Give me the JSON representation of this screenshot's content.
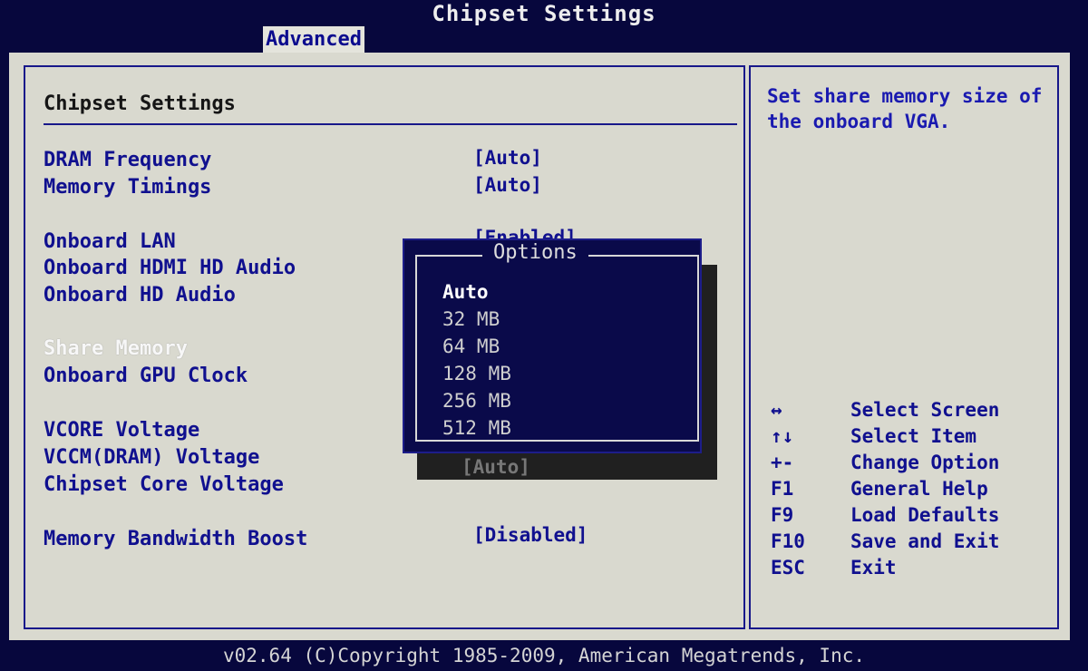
{
  "window": {
    "title": "Chipset Settings",
    "tab": "Advanced"
  },
  "left_panel": {
    "section_title": "Chipset Settings",
    "settings": [
      {
        "label": "DRAM Frequency",
        "value": "[Auto]"
      },
      {
        "label": "Memory Timings",
        "value": "[Auto]"
      },
      {
        "label": "Onboard LAN",
        "value": "[Enabled]"
      },
      {
        "label": "Onboard HDMI HD Audio",
        "value": ""
      },
      {
        "label": "Onboard HD Audio",
        "value": ""
      },
      {
        "label": "Share Memory",
        "value": "",
        "selected": true
      },
      {
        "label": "Onboard GPU Clock",
        "value": ""
      },
      {
        "label": "VCORE Voltage",
        "value": ""
      },
      {
        "label": "VCCM(DRAM) Voltage",
        "value": ""
      },
      {
        "label": "Chipset Core Voltage",
        "value": "[Auto]"
      },
      {
        "label": "Memory Bandwidth Boost",
        "value": "[Disabled]"
      }
    ]
  },
  "options_popup": {
    "title": "Options",
    "items": [
      "Auto",
      "32 MB",
      "64 MB",
      "128 MB",
      "256 MB",
      "512 MB"
    ],
    "selected_index": 0
  },
  "right_panel": {
    "help_text": "Set share memory size of the onboard VGA.",
    "keys": [
      {
        "key": "↔",
        "action": "Select Screen"
      },
      {
        "key": "↑↓",
        "action": "Select Item"
      },
      {
        "key": "+-",
        "action": "Change Option"
      },
      {
        "key": "F1",
        "action": "General Help"
      },
      {
        "key": "F9",
        "action": "Load Defaults"
      },
      {
        "key": "F10",
        "action": "Save and Exit"
      },
      {
        "key": "ESC",
        "action": "Exit"
      }
    ]
  },
  "footer": {
    "text": "v02.64 (C)Copyright 1985-2009, American Megatrends, Inc."
  },
  "colors": {
    "background": "#07073d",
    "panel": "#d9d9cf",
    "text_blue": "#10108f",
    "selected_text": "#f7f7f7"
  }
}
